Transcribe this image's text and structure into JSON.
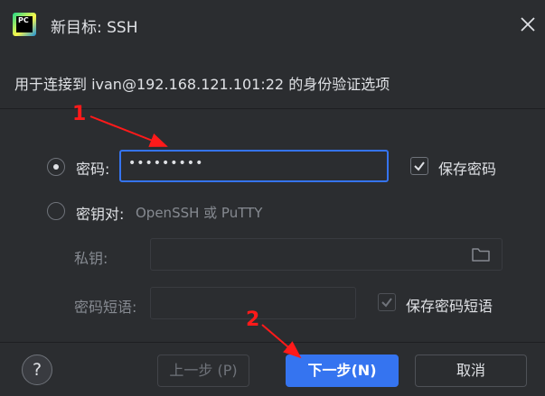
{
  "window": {
    "title": "新目标: SSH",
    "app_icon_text": "PC",
    "close_icon": "close-icon"
  },
  "subtitle": "用于连接到 ivan@192.168.121.101:22 的身份验证选项",
  "auth": {
    "password_option_label": "密码:",
    "password_value": "•••••••••",
    "save_password_label": "保存密码",
    "key_pair_option_label": "密钥对:",
    "key_pair_hint": "OpenSSH 或 PuTTY",
    "private_key_label": "私钥:",
    "private_key_value": "",
    "passphrase_label": "密码短语:",
    "passphrase_value": "",
    "save_passphrase_label": "保存密码短语",
    "folder_icon": "folder-icon"
  },
  "footer": {
    "help_label": "?",
    "prev_label": "上一步 (P)",
    "next_label": "下一步(N)",
    "cancel_label": "取消"
  },
  "annotations": {
    "marker_1": "1",
    "marker_2": "2"
  },
  "colors": {
    "accent": "#3574f0",
    "annotation": "#ff1a1a",
    "background": "#2b2d30"
  }
}
